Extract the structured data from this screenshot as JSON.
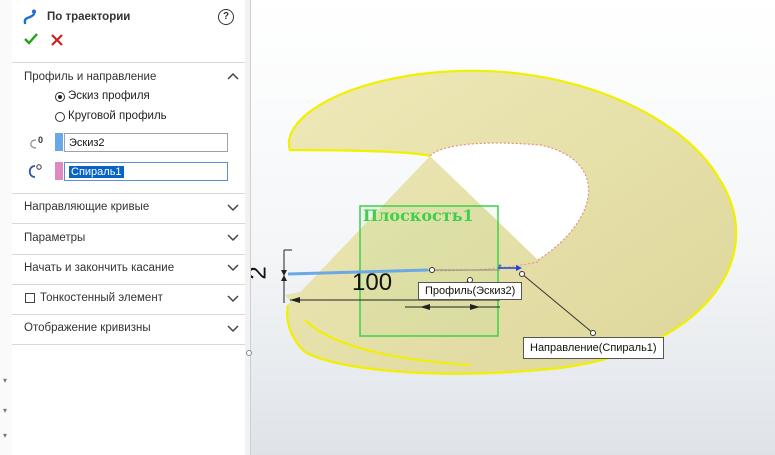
{
  "feature": {
    "title": "По траектории",
    "help_label": "?"
  },
  "sections": {
    "profile_direction": {
      "title": "Профиль и направление",
      "radio_sketch": "Эскиз профиля",
      "radio_circular": "Круговой профиль",
      "profile_value": "Эскиз2",
      "path_value": "Спираль1"
    },
    "guide_curves": "Направляющие кривые",
    "options": "Параметры",
    "tangency": "Начать и закончить касание",
    "thin": "Тонкостенный элемент",
    "curvature": "Отображение кривизны"
  },
  "scene": {
    "plane_label": "Плоскость1",
    "dim_length": "100",
    "dim_height": "2",
    "callout_profile": "Профиль(Эскиз2)",
    "callout_direction": "Направление(Спираль1)"
  },
  "colors": {
    "accept": "#22a022",
    "cancel": "#d02020",
    "profile_tab": "#6aa8e8",
    "path_tab": "#e088c0",
    "surface": "#e6e0a4",
    "edge": "#f0f000",
    "plane": "#3fd04a"
  },
  "icons": [
    "sweep-icon",
    "help-icon",
    "ok-check-icon",
    "cancel-x-icon",
    "chevron-up-icon",
    "chevron-down-icon",
    "profile-select-icon",
    "path-select-icon"
  ]
}
